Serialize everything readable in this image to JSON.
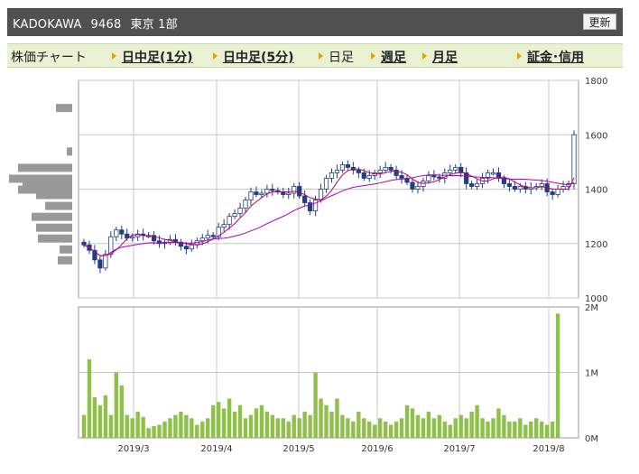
{
  "header": {
    "company": "KADOKAWA",
    "code": "9468",
    "market": "東京 1部",
    "refresh_label": "更新"
  },
  "tabs": {
    "chart_label": "株価チャート",
    "intraday1": "日中足(1分)",
    "intraday5": "日中足(5分)",
    "daily": "日足",
    "weekly": "週足",
    "monthly": "月足",
    "margin": "証金･信用"
  },
  "colors": {
    "candle_up": "#ffffff",
    "candle_down": "#1f3f80",
    "ma_short": "#c0006a",
    "ma_long": "#b000c0",
    "volume": "#8fc04a",
    "volume_profile": "#999999",
    "grid": "#c8c8c8"
  },
  "chart_data": [
    {
      "type": "candlestick",
      "x_labels": [
        "2019/3",
        "2019/4",
        "2019/5",
        "2019/6",
        "2019/7",
        "2019/8"
      ],
      "ylim": [
        1000,
        1800
      ],
      "y_ticks": [
        "1800",
        "1600",
        "1400",
        "1200",
        "1000"
      ],
      "moving_averages": [
        "short",
        "long"
      ],
      "close": [
        1195,
        1175,
        1140,
        1110,
        1160,
        1225,
        1250,
        1235,
        1220,
        1225,
        1235,
        1230,
        1230,
        1210,
        1200,
        1205,
        1215,
        1205,
        1190,
        1180,
        1195,
        1210,
        1220,
        1230,
        1225,
        1260,
        1270,
        1300,
        1310,
        1330,
        1360,
        1390,
        1380,
        1385,
        1400,
        1395,
        1390,
        1380,
        1385,
        1410,
        1375,
        1350,
        1320,
        1360,
        1400,
        1440,
        1460,
        1470,
        1490,
        1480,
        1470,
        1460,
        1440,
        1450,
        1460,
        1470,
        1480,
        1470,
        1450,
        1440,
        1425,
        1400,
        1410,
        1430,
        1450,
        1445,
        1440,
        1460,
        1470,
        1480,
        1460,
        1420,
        1410,
        1420,
        1440,
        1460,
        1460,
        1440,
        1420,
        1410,
        1400,
        1410,
        1400,
        1405,
        1410,
        1420,
        1390,
        1380,
        1400,
        1410,
        1420,
        1600
      ],
      "volume_ylim": [
        0,
        2000000
      ],
      "volume_ticks": [
        "2M",
        "1M",
        "0M"
      ],
      "volume": [
        350000,
        1200000,
        620000,
        500000,
        650000,
        350000,
        1000000,
        800000,
        350000,
        300000,
        400000,
        320000,
        150000,
        180000,
        200000,
        250000,
        300000,
        350000,
        400000,
        350000,
        300000,
        200000,
        250000,
        300000,
        500000,
        550000,
        450000,
        600000,
        400000,
        500000,
        300000,
        350000,
        450000,
        500000,
        400000,
        350000,
        300000,
        300000,
        250000,
        350000,
        300000,
        400000,
        350000,
        1000000,
        600000,
        500000,
        400000,
        600000,
        350000,
        300000,
        250000,
        400000,
        300000,
        250000,
        200000,
        300000,
        250000,
        200000,
        250000,
        300000,
        500000,
        450000,
        350000,
        300000,
        400000,
        300000,
        350000,
        250000,
        200000,
        300000,
        350000,
        300000,
        400000,
        500000,
        300000,
        250000,
        300000,
        450000,
        350000,
        250000,
        250000,
        300000,
        200000,
        250000,
        300000,
        250000,
        200000,
        250000,
        1900000
      ]
    }
  ]
}
